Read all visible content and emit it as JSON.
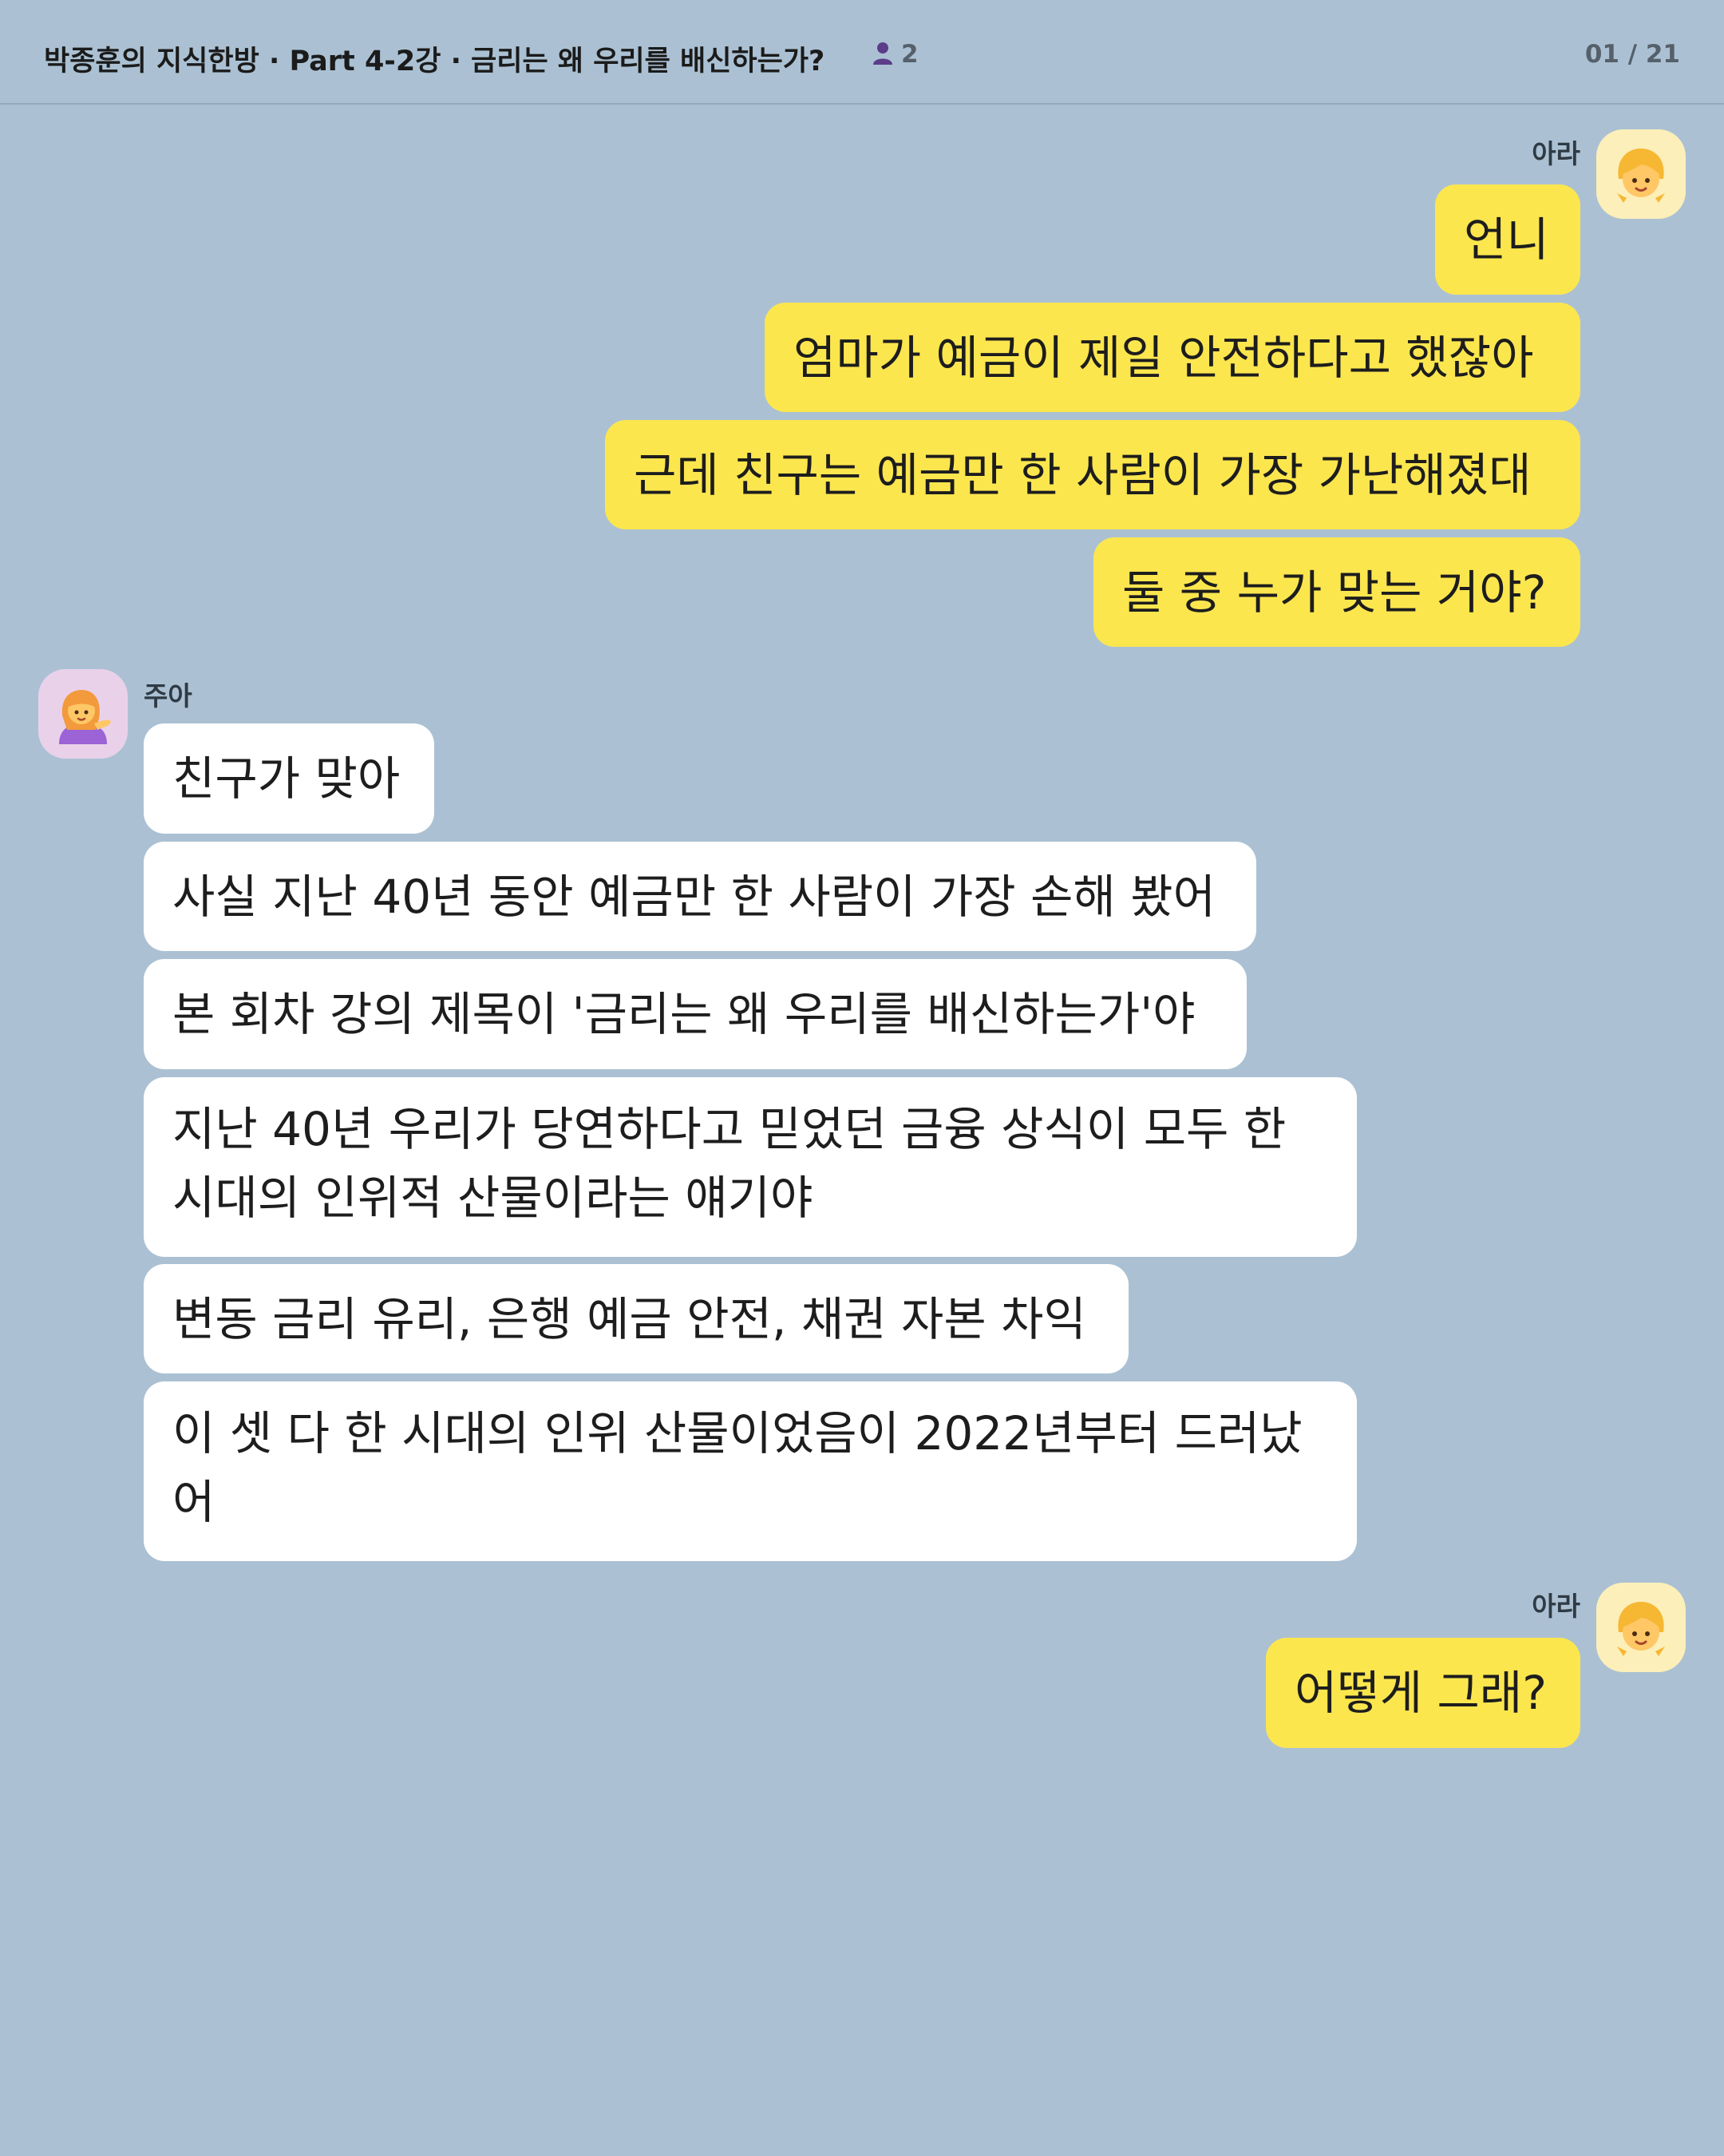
{
  "header": {
    "title": "박종훈의 지식한방 · Part 4-2강 · 금리는 왜 우리를 배신하는가?",
    "member_icon": "person-icon",
    "member_count": "2",
    "page_indicator": "01 / 21"
  },
  "colors": {
    "background": "#abc1d3",
    "my_bubble": "#fce64e",
    "their_bubble": "#ffffff"
  },
  "messages": [
    {
      "sender": "아라",
      "avatar_icon": "girl-emoji-icon",
      "side": "right",
      "texts": [
        "언니",
        "엄마가 예금이 제일 안전하다고 했잖아",
        "근데 친구는 예금만 한 사람이 가장 가난해졌대",
        "둘 중 누가 맞는 거야?"
      ]
    },
    {
      "sender": "주아",
      "avatar_icon": "woman-tipping-hand-emoji-icon",
      "side": "left",
      "texts": [
        "친구가 맞아",
        "사실 지난 40년 동안 예금만 한 사람이 가장 손해 봤어",
        "본 회차 강의 제목이 '금리는 왜 우리를 배신하는가'야",
        "지난 40년 우리가 당연하다고 믿었던 금융 상식이 모두 한 시대의 인위적 산물이라는 얘기야",
        "변동 금리 유리, 은행 예금 안전, 채권 자본 차익",
        "이 셋 다 한 시대의 인위 산물이었음이 2022년부터 드러났어"
      ]
    },
    {
      "sender": "아라",
      "avatar_icon": "girl-emoji-icon",
      "side": "right",
      "texts": [
        "어떻게 그래?"
      ]
    }
  ]
}
